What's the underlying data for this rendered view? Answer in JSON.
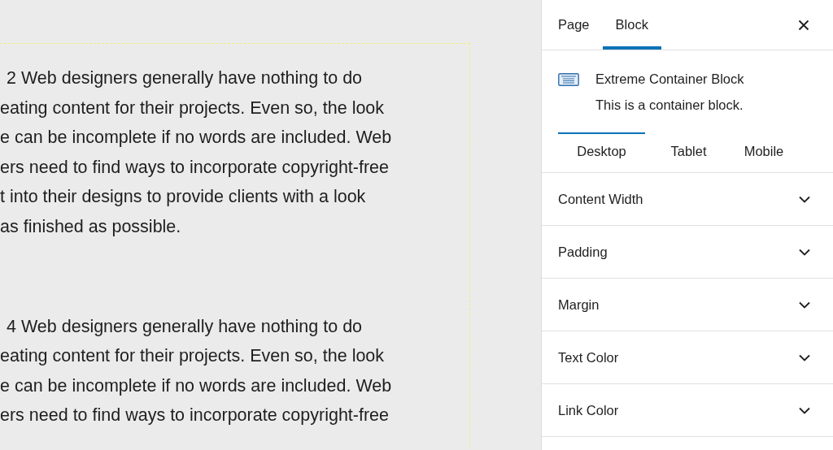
{
  "canvas": {
    "paragraphs": [
      {
        "lines": [
          "2 Web designers generally have nothing to do",
          "eating content for their projects. Even so, the look",
          "e can be incomplete if no words are included. Web",
          "ers need to find ways to incorporate copyright-free",
          "t into their designs to provide clients with a look",
          "as finished as possible."
        ]
      },
      {
        "lines": [
          "4 Web designers generally have nothing to do",
          "eating content for their projects. Even so, the look",
          "e can be incomplete if no words are included. Web",
          "ers need to find ways to incorporate copyright-free"
        ]
      }
    ]
  },
  "sidebar": {
    "tabs": [
      {
        "label": "Page",
        "selected": false
      },
      {
        "label": "Block",
        "selected": true
      }
    ],
    "block": {
      "title": "Extreme Container Block",
      "description": "This is a container block."
    },
    "device_tabs": [
      {
        "label": "Desktop",
        "selected": true
      },
      {
        "label": "Tablet",
        "selected": false
      },
      {
        "label": "Mobile",
        "selected": false
      }
    ],
    "panels": [
      {
        "title": "Content Width",
        "expanded": false
      },
      {
        "title": "Padding",
        "expanded": false
      },
      {
        "title": "Margin",
        "expanded": false
      },
      {
        "title": "Text Color",
        "expanded": false
      },
      {
        "title": "Link Color",
        "expanded": false
      }
    ]
  }
}
